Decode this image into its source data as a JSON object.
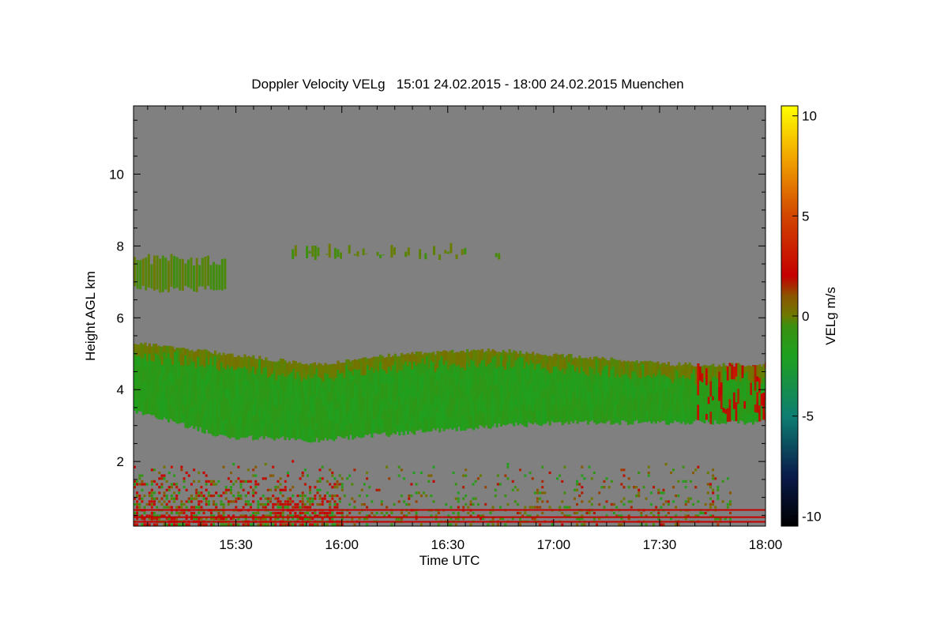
{
  "chart_data": {
    "type": "heatmap",
    "title": "Doppler Velocity VELg   15:01 24.02.2015 - 18:00 24.02.2015 Muenchen",
    "xlabel": "Time UTC",
    "ylabel": "Height AGL km",
    "xlim": [
      "15:01",
      "18:00"
    ],
    "ylim": [
      0.2,
      11.9
    ],
    "x_ticks": [
      "15:30",
      "16:00",
      "16:30",
      "17:00",
      "17:30",
      "18:00"
    ],
    "y_ticks": [
      2,
      4,
      6,
      8,
      10
    ],
    "background_color": "#808080",
    "colorbar": {
      "label": "VELg m/s",
      "range": [
        -10.5,
        10.5
      ],
      "ticks": [
        -10,
        -5,
        0,
        5,
        10
      ],
      "stops": [
        {
          "v": -10.5,
          "color": "#000000"
        },
        {
          "v": -8,
          "color": "#0a1a4a"
        },
        {
          "v": -5,
          "color": "#0e7e72"
        },
        {
          "v": -2,
          "color": "#1fa01f"
        },
        {
          "v": -0.5,
          "color": "#3a9010"
        },
        {
          "v": 0,
          "color": "#6e7a00"
        },
        {
          "v": 1,
          "color": "#8a5500"
        },
        {
          "v": 2,
          "color": "#c40000"
        },
        {
          "v": 5,
          "color": "#d24500"
        },
        {
          "v": 8,
          "color": "#f2a800"
        },
        {
          "v": 10.5,
          "color": "#ffff00"
        }
      ]
    },
    "regions": [
      {
        "name": "main cloud layer",
        "t0": "15:01",
        "t1": "18:00",
        "base_km": [
          3.4,
          2.7,
          2.6,
          2.8,
          3.0,
          3.1,
          3.1,
          3.1
        ],
        "top_km": [
          5.3,
          5.0,
          4.7,
          5.0,
          5.1,
          4.9,
          4.7,
          4.7
        ],
        "velocity_ms": [
          -1,
          -2
        ]
      },
      {
        "name": "upper cloud fragment",
        "t0": "15:01",
        "t1": "15:27",
        "base_km": 6.7,
        "top_km": 7.8,
        "velocity_ms": [
          0,
          -0.5
        ]
      },
      {
        "name": "upper patches",
        "t0": "15:45",
        "t1": "16:45",
        "base_km": 7.6,
        "top_km": 8.1,
        "velocity_ms": [
          0,
          -0.5
        ]
      },
      {
        "name": "boundary layer echoes",
        "t0": "15:01",
        "t1": "17:50",
        "base_km": 0.2,
        "top_km": 2.0,
        "velocity_ms": [
          -2,
          2
        ]
      }
    ],
    "horizontal_lines_km": [
      0.32,
      0.45,
      0.65
    ]
  }
}
